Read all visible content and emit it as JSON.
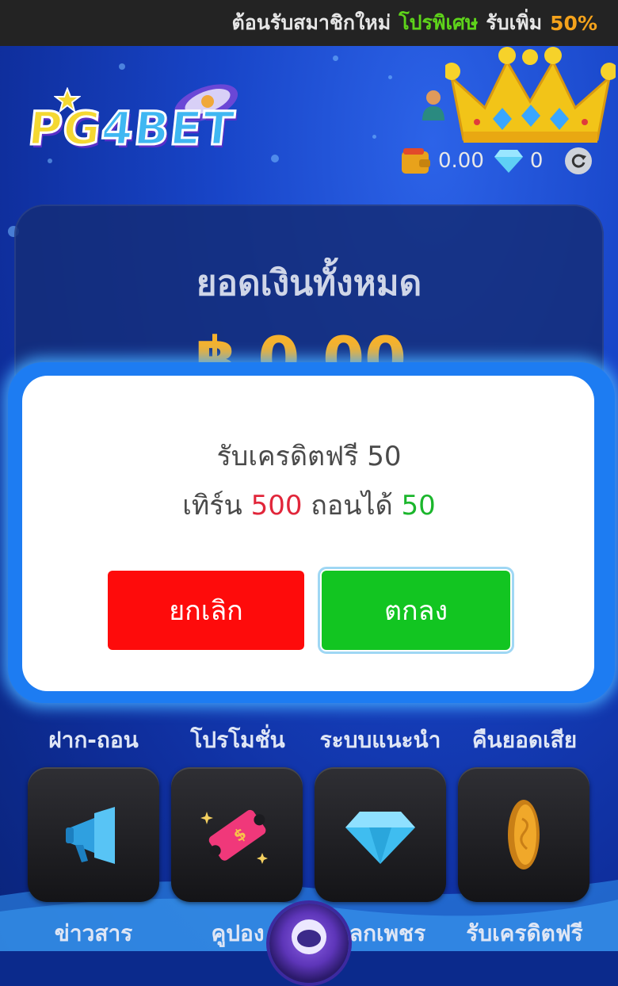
{
  "marquee": {
    "text_prefix": "ต้อนรับสมาชิกใหม่",
    "text_highlight": "โปรพิเศษ",
    "text_mid": "รับเพิ่ม",
    "text_percent": "50%"
  },
  "logo": {
    "part1": "PG",
    "part2": "4BET"
  },
  "header": {
    "wallet_balance": "0.00",
    "diamond_count": "0",
    "icons": [
      "user-icon",
      "crown-icon",
      "wallet-icon",
      "diamond-icon",
      "refresh-icon"
    ]
  },
  "balance_card": {
    "title": "ยอดเงินทั้งหมด",
    "amount": "฿ 0.00"
  },
  "modal": {
    "line1": "รับเครดิตฟรี 50",
    "line2_prefix": "เทิร์น",
    "turnover": "500",
    "line2_mid": "ถอนได้",
    "withdraw": "50",
    "cancel_label": "ยกเลิก",
    "ok_label": "ตกลง"
  },
  "menu_row1": [
    {
      "label": "ฝาก-ถอน"
    },
    {
      "label": "โปรโมชั่น"
    },
    {
      "label": "ระบบแนะนำ"
    },
    {
      "label": "คืนยอดเสีย"
    }
  ],
  "menu_row2": [
    {
      "label": "ข่าวสาร",
      "icon": "megaphone-icon"
    },
    {
      "label": "คูปอง",
      "icon": "coupon-icon"
    },
    {
      "label": "แลกเพชร",
      "icon": "diamond-icon"
    },
    {
      "label": "รับเครดิตฟรี",
      "icon": "coin-icon"
    }
  ],
  "colors": {
    "cancel": "#fe0b0b",
    "ok": "#12c521",
    "accent_gold": "#f6b22d",
    "highlight_green": "#5ed31a"
  }
}
